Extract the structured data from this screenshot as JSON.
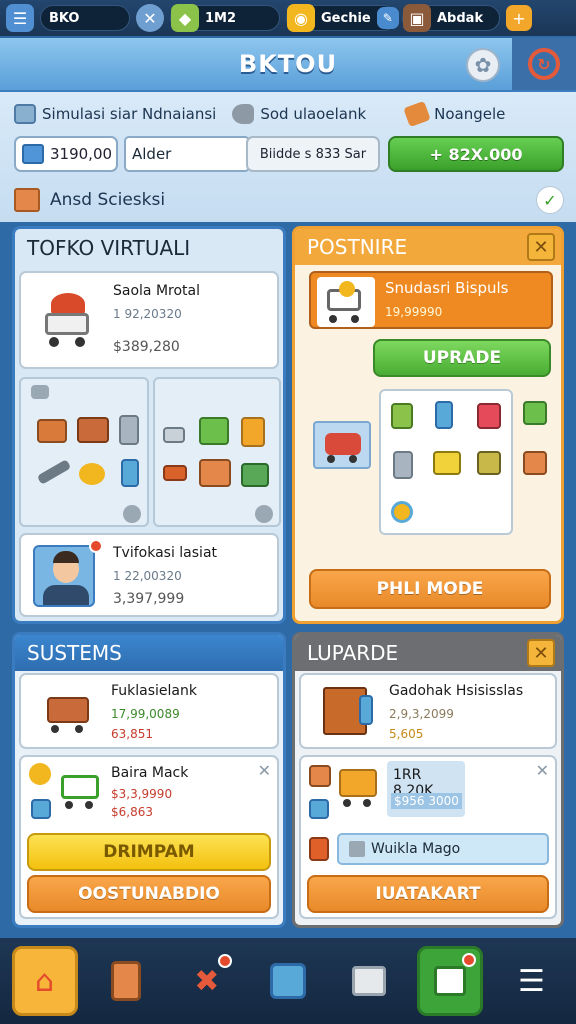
{
  "status_bar": {
    "label_left": "BKO",
    "resource_1": "1M2",
    "resource_2": "Gechie",
    "resource_3": "Abdak"
  },
  "header": {
    "title": "BKTOU"
  },
  "info_tabs": [
    {
      "label": "Simulasi siar Ndnaiansi",
      "icon": "box-icon"
    },
    {
      "label": "Sod ulaoelank",
      "icon": "tag-icon"
    },
    {
      "label": "Noangele",
      "icon": "orange-tag-icon"
    }
  ],
  "coins": {
    "value": "3190,00"
  },
  "name_field": {
    "value": "Alder"
  },
  "mid_box": {
    "value": "Biidde s 833 Sar"
  },
  "green_button": {
    "label": "+ 82X.000"
  },
  "row3": {
    "label": "Ansd Sciesksi"
  },
  "panel_toko": {
    "title": "TOFKO VIRTUALI",
    "card1": {
      "title": "Saola Mrotal",
      "stat": "1 92,20320",
      "price": "$389,280"
    },
    "card2": {
      "title": "Tvifokasi lasiat",
      "stat": "1 22,00320",
      "price": "3,397,999"
    }
  },
  "panel_postnire": {
    "title": "POSTNIRE",
    "card": {
      "title": "Snudasri Bispuls",
      "stat": "19,99990"
    },
    "upgrade_label": "UPRADE",
    "bottom_button": "PHLI MODE"
  },
  "panel_sustems": {
    "title": "SUSTEMS",
    "card1": {
      "title": "Fuklasielank",
      "stat1": "17,99,0089",
      "stat2": "63,851"
    },
    "card2": {
      "title": "Baira Mack",
      "stat1": "$3,3,9990",
      "stat2": "$6,863"
    },
    "button_yellow": "DRIMPAM",
    "button_orange": "OOSTUNABDIO"
  },
  "panel_luparde": {
    "title": "LUPARDE",
    "card1": {
      "title": "Gadohak Hsisisslas",
      "stat1": "2,9,3,2099",
      "stat2": "5,605"
    },
    "card2": {
      "title": "1RR 8,20K",
      "price": "$956 3000"
    },
    "info_field": "Wuikla Mago",
    "button_orange": "IUATAKART"
  },
  "nav": [
    "home-icon",
    "tablet-icon",
    "tools-icon",
    "device-icon",
    "bag-icon",
    "image-icon",
    "menu-icon"
  ],
  "colors": {
    "accent_blue": "#3b7bc0",
    "accent_orange": "#f0a030",
    "accent_green": "#49ad33",
    "dark_bg": "#1e3754"
  }
}
